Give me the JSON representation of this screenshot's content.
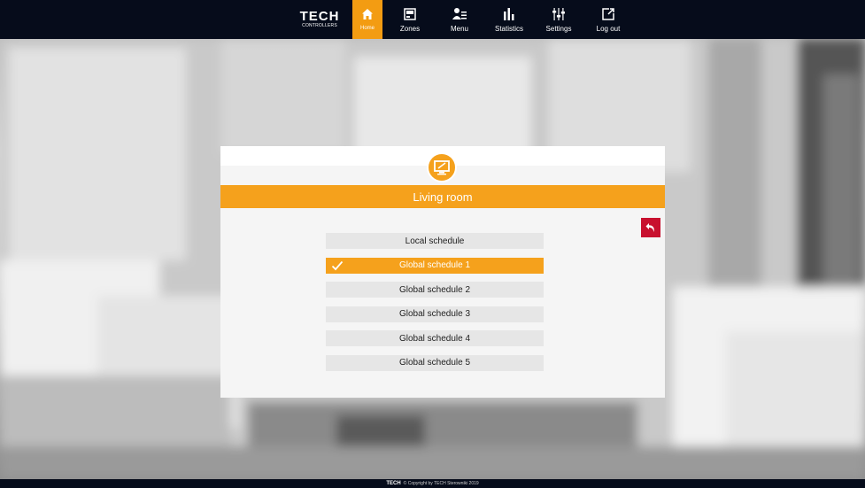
{
  "brand": {
    "name": "TECH",
    "tagline": "CONTROLLERS"
  },
  "nav": {
    "items": [
      {
        "label": "Home",
        "icon": "home-icon",
        "active": true
      },
      {
        "label": "Zones",
        "icon": "zones-icon",
        "active": false
      },
      {
        "label": "Menu",
        "icon": "menu-icon",
        "active": false
      },
      {
        "label": "Statistics",
        "icon": "statistics-icon",
        "active": false
      },
      {
        "label": "Settings",
        "icon": "settings-icon",
        "active": false
      },
      {
        "label": "Log out",
        "icon": "logout-icon",
        "active": false
      }
    ]
  },
  "panel": {
    "title": "Living room",
    "zone_icon": "monitor-icon",
    "back_icon": "back-arrow-icon",
    "schedules": [
      {
        "label": "Local schedule",
        "selected": false
      },
      {
        "label": "Global schedule 1",
        "selected": true
      },
      {
        "label": "Global schedule 2",
        "selected": false
      },
      {
        "label": "Global schedule 3",
        "selected": false
      },
      {
        "label": "Global schedule 4",
        "selected": false
      },
      {
        "label": "Global schedule 5",
        "selected": false
      }
    ]
  },
  "footer": {
    "brand": "TECH",
    "text": "© Copyright by TECH Sterowniki 2019"
  },
  "colors": {
    "accent": "#f5a11c",
    "topbar": "#060c1b",
    "back_button": "#c8102e",
    "item_bg": "#e6e6e6",
    "panel_bg": "#f5f5f5"
  }
}
